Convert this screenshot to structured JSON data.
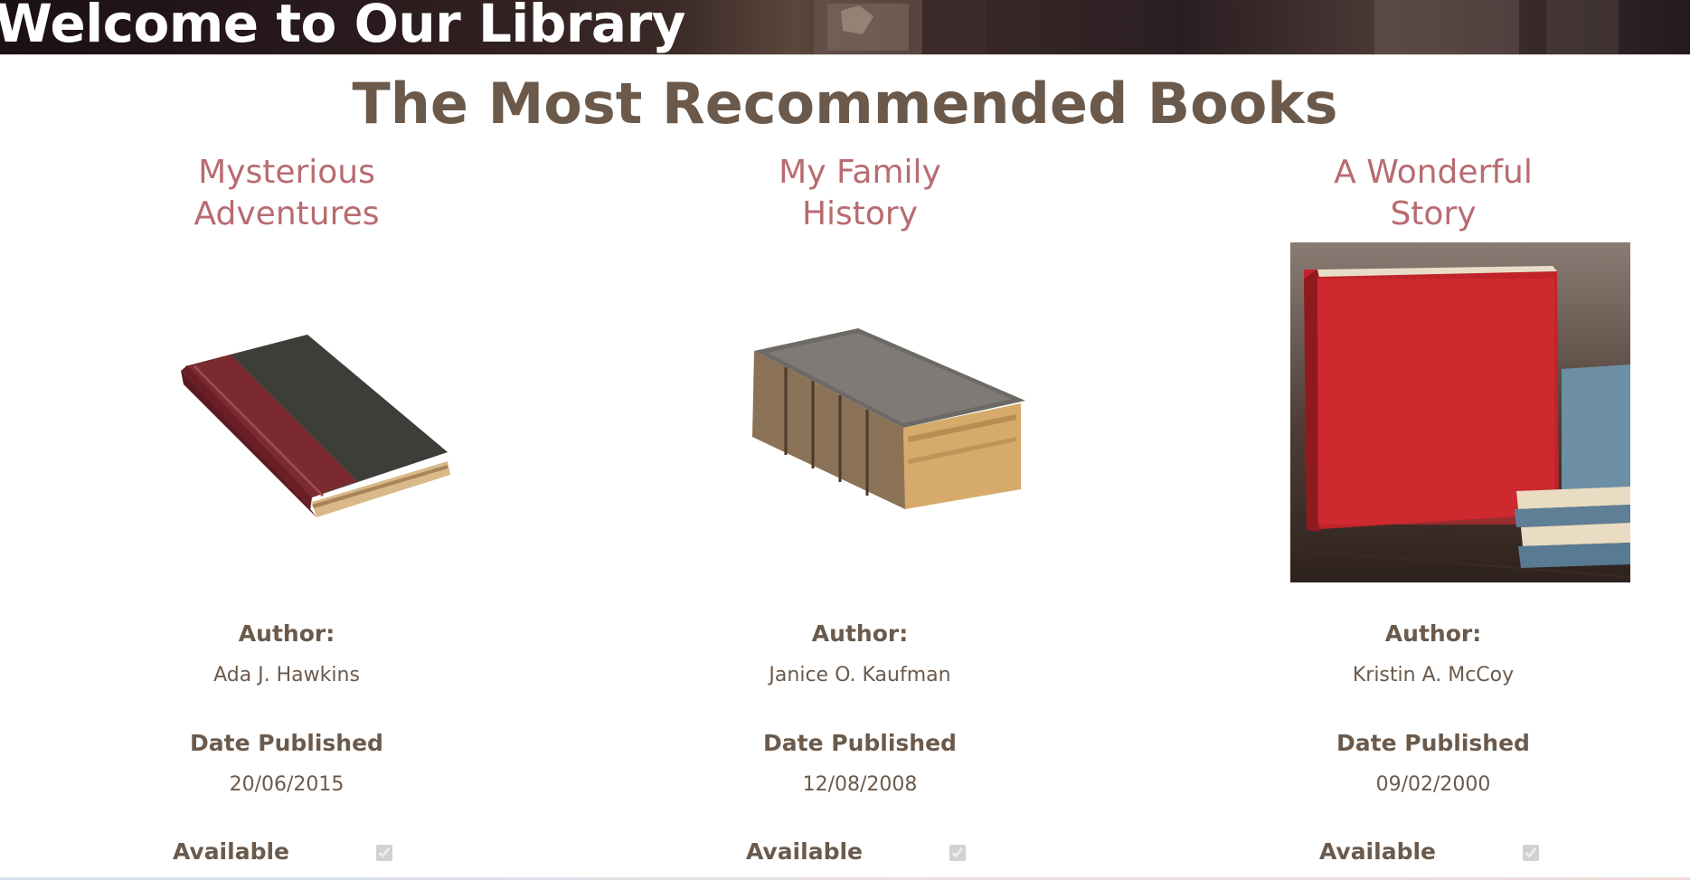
{
  "banner": {
    "title": "Welcome to Our Library"
  },
  "page": {
    "title": "The Most Recommended Books"
  },
  "labels": {
    "author": "Author:",
    "date_published": "Date Published",
    "available": "Available"
  },
  "books": [
    {
      "title_line1": "Mysterious",
      "title_line2": "Adventures",
      "author": "Ada J. Hawkins",
      "date_published": "20/06/2015",
      "available": true
    },
    {
      "title_line1": "My Family",
      "title_line2": "History",
      "author": "Janice O. Kaufman",
      "date_published": "12/08/2008",
      "available": true
    },
    {
      "title_line1": "A Wonderful",
      "title_line2": "Story",
      "author": "Kristin A. McCoy",
      "date_published": "09/02/2000",
      "available": true
    }
  ],
  "colors": {
    "heading": "#6b5a4b",
    "book_title": "#b86b70",
    "banner_text": "#ffffff"
  }
}
